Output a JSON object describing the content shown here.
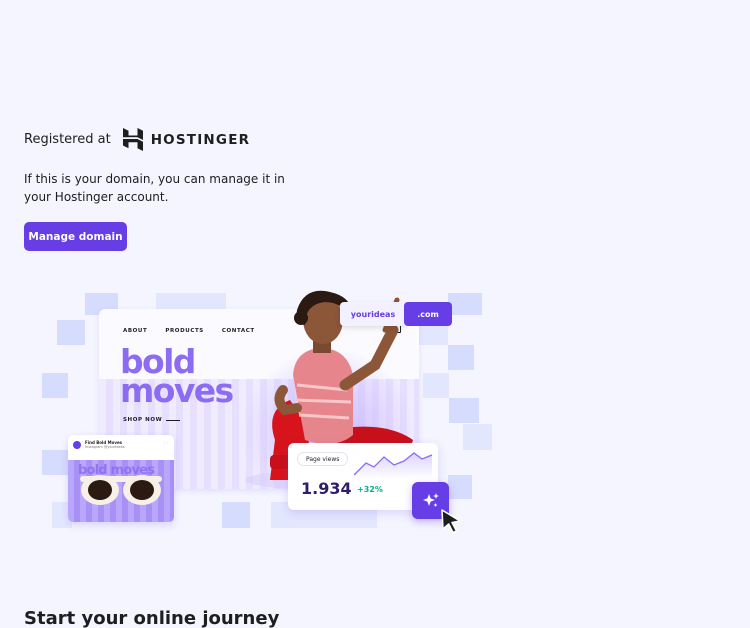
{
  "registration": {
    "label": "Registered at",
    "registrar": "HOSTINGER",
    "logo_icon": "hostinger-logo-icon"
  },
  "description": "If this is your domain, you can manage it in your Hostinger account.",
  "actions": {
    "manage_label": "Manage domain"
  },
  "illustration": {
    "nav": [
      "ABOUT",
      "PRODUCTS",
      "CONTACT"
    ],
    "headline_line1": "bold",
    "headline_line2": "moves",
    "shop_now": "SHOP NOW",
    "domain_name": "yourideas",
    "domain_tld": ".com",
    "social_card": {
      "name": "Find Bold Moves",
      "handle": "Instagram @yourideas",
      "image_text": "bold moves"
    },
    "analytics": {
      "label": "Page views",
      "value": "1.934",
      "delta": "+32%"
    },
    "icons": [
      "bag-icon",
      "sparkle-icon",
      "cursor-icon"
    ]
  },
  "section_heading": "Start your online journey",
  "colors": {
    "accent": "#673de6",
    "background": "#f4f5ff",
    "tile": "#d6dcfd",
    "headline": "#8c6cf2",
    "positive": "#00b090"
  }
}
